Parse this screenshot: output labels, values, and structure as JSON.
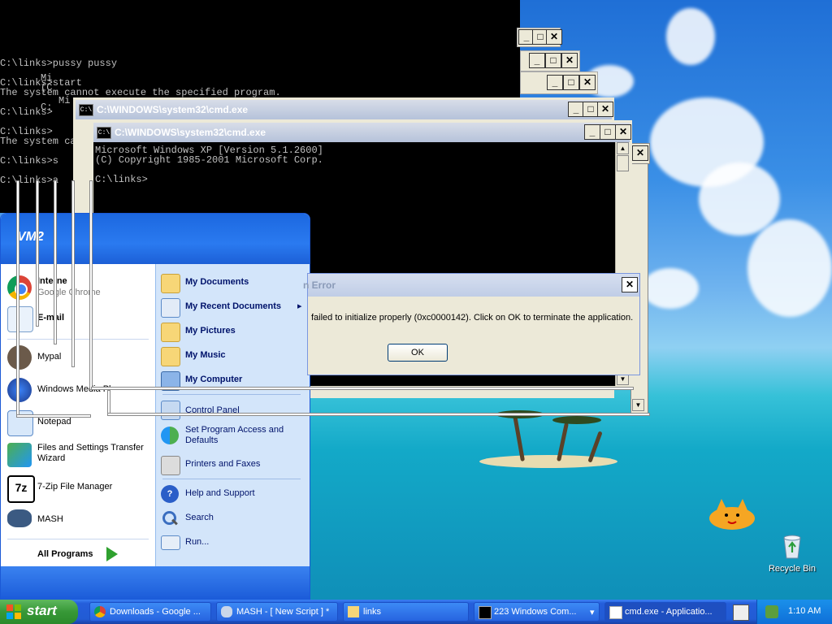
{
  "console_back": {
    "lines": [
      "C:\\links>pussy pussy",
      "",
      "C:\\links>start",
      "The system cannot execute the specified program.",
      "",
      "C:\\links>",
      "",
      "C:\\links>",
      "The system cannot",
      "",
      "C:\\links>s",
      "",
      "C:\\links>a"
    ]
  },
  "cmd_window_2": {
    "title": "C:\\WINDOWS\\system32\\cmd.exe"
  },
  "cmd_window_main": {
    "title": "C:\\WINDOWS\\system32\\cmd.exe",
    "lines": [
      "Microsoft Windows XP [Version 5.1.2600]",
      "(C) Copyright 1985-2001 Microsoft Corp.",
      "",
      "C:\\links>"
    ]
  },
  "ghost_overlays": [
    "Mi",
    "(C",
    "Mi",
    "C:",
    "Mi",
    "(C",
    "C:"
  ],
  "window_buttons": {
    "minimize": "_",
    "maximize": "□",
    "close": "✕"
  },
  "error_dialog": {
    "title": "n Error",
    "message": "failed to initialize properly (0xc0000142). Click on OK to terminate the application.",
    "ok_label": "OK",
    "close": "✕"
  },
  "start_menu": {
    "user": "VM2",
    "pinned": [
      {
        "name": "Interne",
        "sub": "Google Chrome",
        "icon": "chrome-icon"
      },
      {
        "name": "E-mail",
        "sub": "",
        "icon": "email-icon"
      }
    ],
    "recent": [
      {
        "name": "Mypal",
        "icon": "mypal-icon"
      },
      {
        "name": "Windows Media Pl",
        "icon": "media-player-icon"
      },
      {
        "name": "Notepad",
        "icon": "notepad-icon"
      },
      {
        "name": "Files and Settings Transfer Wizard",
        "icon": "transfer-wizard-icon"
      },
      {
        "name": "7-Zip File Manager",
        "icon": "7zip-icon"
      },
      {
        "name": "MASH",
        "icon": "mash-icon"
      }
    ],
    "all_programs": "All Programs",
    "right": [
      {
        "name": "My Documents",
        "icon": "folder-icon"
      },
      {
        "name": "My Recent Documents",
        "icon": "recent-icon",
        "arrow": "▸"
      },
      {
        "name": "My Pictures",
        "icon": "folder-icon"
      },
      {
        "name": "My Music",
        "icon": "folder-icon"
      },
      {
        "name": "My Computer",
        "icon": "computer-icon"
      },
      {
        "name": "Control Panel",
        "icon": "control-panel-icon"
      },
      {
        "name": "Set Program Access and Defaults",
        "icon": "program-access-icon"
      },
      {
        "name": "Printers and Faxes",
        "icon": "printer-icon"
      },
      {
        "name": "Help and Support",
        "icon": "help-icon"
      },
      {
        "name": "Search",
        "icon": "search-icon"
      },
      {
        "name": "Run...",
        "icon": "run-icon"
      }
    ]
  },
  "desktop_icons": [
    {
      "label": "Recycle Bin",
      "icon": "recycle-bin-icon"
    }
  ],
  "taskbar": {
    "start_label": "start",
    "tasks": [
      {
        "label": "Downloads - Google ...",
        "icon": "chrome-icon"
      },
      {
        "label": "MASH - [ New Script ] *",
        "icon": "mash-icon"
      },
      {
        "label": "links",
        "icon": "folder-icon"
      },
      {
        "label": "223 Windows Com...",
        "icon": "cmd-icon"
      },
      {
        "label": "cmd.exe - Applicatio...",
        "icon": "window-icon"
      }
    ],
    "clock": "1:10 AM"
  },
  "colors": {
    "xp_blue": "#245edb",
    "start_green": "#379837",
    "console_bg": "#000000",
    "dialog_bg": "#ece9d8"
  }
}
